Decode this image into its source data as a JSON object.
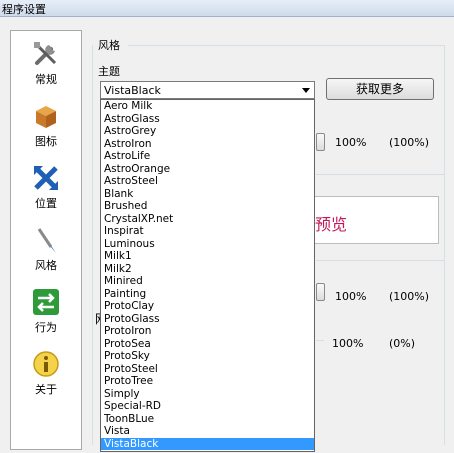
{
  "window": {
    "title": "程序设置"
  },
  "sidebar": {
    "items": [
      {
        "label": "常规",
        "icon": "tools-icon"
      },
      {
        "label": "图标",
        "icon": "box-icon"
      },
      {
        "label": "位置",
        "icon": "arrows-icon"
      },
      {
        "label": "风格",
        "icon": "brush-icon"
      },
      {
        "label": "行为",
        "icon": "switch-arrows-icon"
      },
      {
        "label": "关于",
        "icon": "info-icon"
      }
    ]
  },
  "style": {
    "group_title": "风格",
    "theme_label": "主题",
    "theme_selected": "VistaBlack",
    "get_more_label": "获取更多",
    "preview_text": "预览",
    "row1": {
      "value": "100%",
      "paren": "(100%)"
    },
    "row2": {
      "value": "100%",
      "paren": "(100%)"
    },
    "row3": {
      "value": "100%",
      "paren": "(0%)"
    },
    "partial_label": "网"
  },
  "theme_options": [
    "Aero Milk",
    "AstroGlass",
    "AstroGrey",
    "AstroIron",
    "AstroLife",
    "AstroOrange",
    "AstroSteel",
    "Blank",
    "Brushed",
    "CrystalXP.net",
    "Inspirat",
    "Luminous",
    "Milk1",
    "Milk2",
    "Minired",
    "Painting",
    "ProtoClay",
    "ProtoGlass",
    "ProtoIron",
    "ProtoSea",
    "ProtoSky",
    "ProtoSteel",
    "ProtoTree",
    "Simply",
    "Special-RD",
    "ToonBLue",
    "Vista",
    "VistaBlack"
  ],
  "colors": {
    "selection": "#3399ff",
    "preview_text": "#c2185b"
  }
}
